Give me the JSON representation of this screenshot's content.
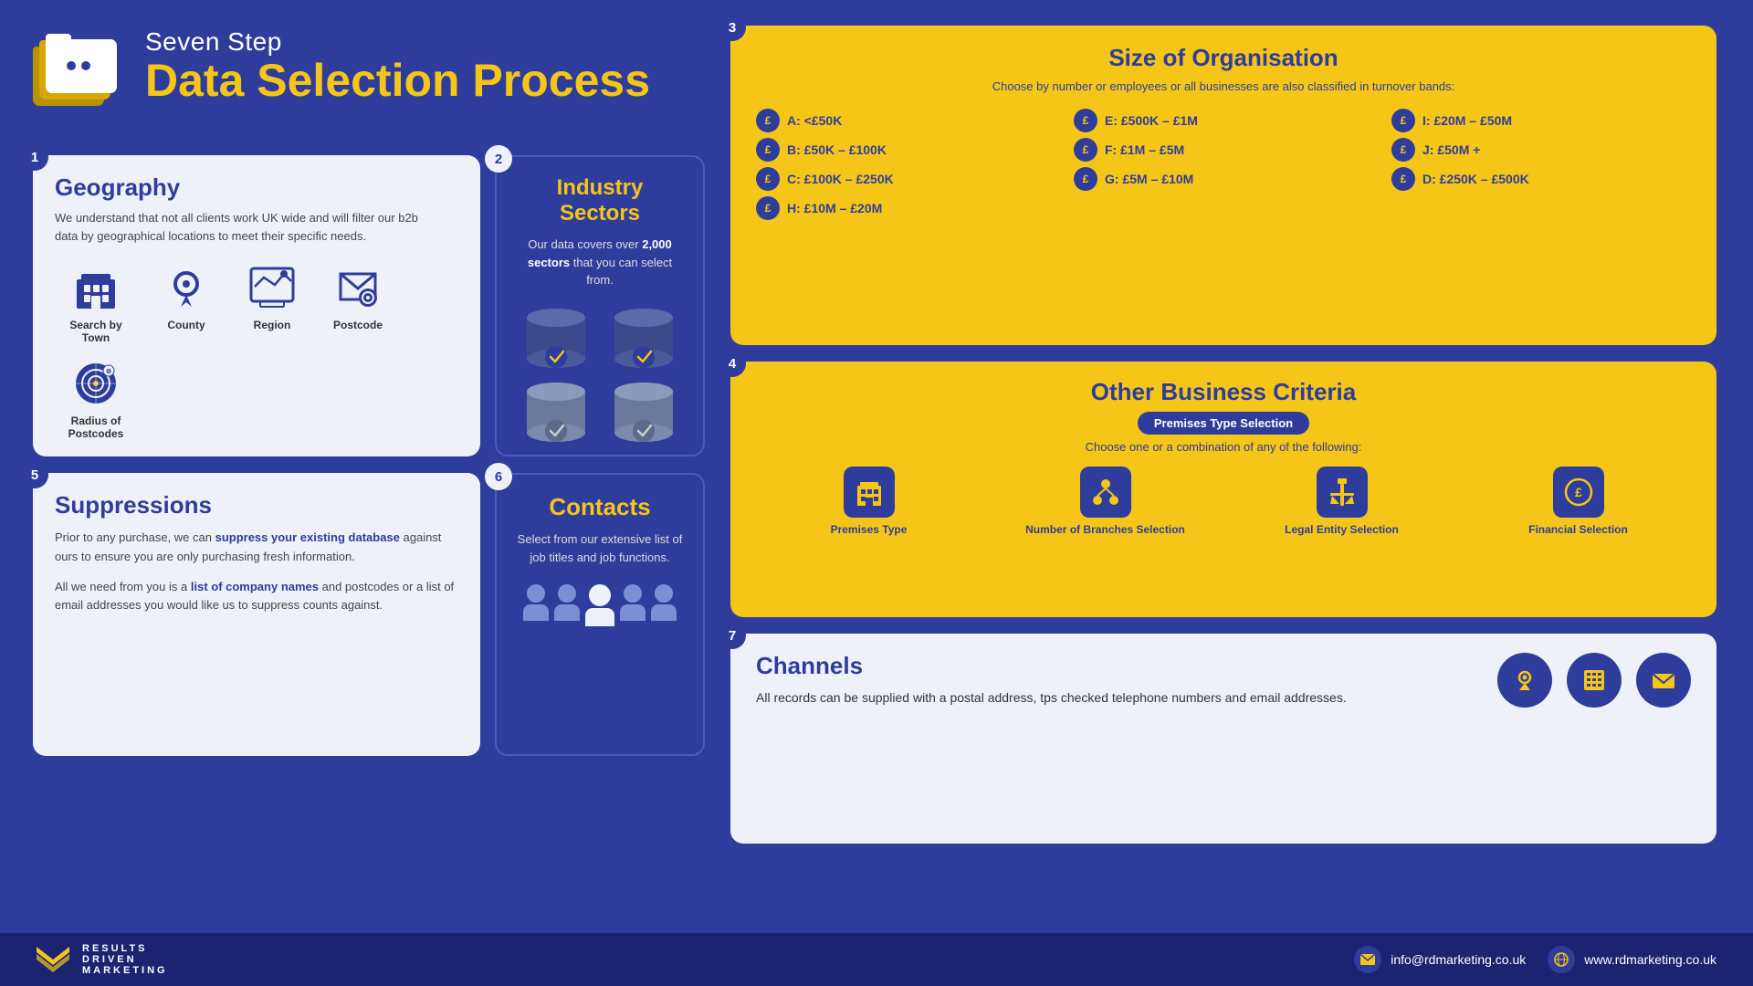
{
  "title": "Seven Step Data Selection Process",
  "header": {
    "line1": "Seven Step",
    "line2": "Data Selection Process"
  },
  "steps": {
    "step1": {
      "num": "1",
      "title": "Geography",
      "desc": "We understand that not all clients work UK wide and will filter our b2b data by geographical locations to meet their specific needs.",
      "geo_options": [
        {
          "label": "Search by Town",
          "icon": "🏙"
        },
        {
          "label": "County",
          "icon": "📍"
        },
        {
          "label": "Region",
          "icon": "🗺"
        },
        {
          "label": "Postcode",
          "icon": "📮"
        },
        {
          "label": "Radius of Postcodes",
          "icon": "🎯"
        }
      ]
    },
    "step2": {
      "num": "2",
      "title": "Industry Sectors",
      "desc": "Our data covers over 2,000 sectors that you can select from.",
      "desc_bold": "2,000"
    },
    "step3": {
      "num": "3",
      "title": "Size of Organisation",
      "desc": "Choose by number or employees or all businesses are also classified in turnover bands:",
      "bands": [
        {
          "id": "A",
          "label": "A: <£50K"
        },
        {
          "id": "B",
          "label": "B: £50K – £100K"
        },
        {
          "id": "C",
          "label": "C: £100K – £250K"
        },
        {
          "id": "D",
          "label": "D: £250K – £500K"
        },
        {
          "id": "E",
          "label": "E: £500K – £1M"
        },
        {
          "id": "F",
          "label": "F: £1M – £5M"
        },
        {
          "id": "G",
          "label": "G: £5M – £10M"
        },
        {
          "id": "H",
          "label": "H: £10M – £20M"
        },
        {
          "id": "I",
          "label": "I: £20M – £50M"
        },
        {
          "id": "J",
          "label": "J: £50M +"
        }
      ]
    },
    "step4": {
      "num": "4",
      "title": "Other Business Criteria",
      "badge": "Premises Type Selection",
      "desc": "Choose one or a combination of any of the following:",
      "criteria": [
        {
          "label": "Premises Type",
          "icon": "🏢"
        },
        {
          "label": "Number of Branches Selection",
          "icon": "👥"
        },
        {
          "label": "Legal Entity Selection",
          "icon": "⚖"
        },
        {
          "label": "Financial Selection",
          "icon": "💷"
        }
      ]
    },
    "step5": {
      "num": "5",
      "title": "Suppressions",
      "desc1": "Prior to any purchase, we can suppress your existing database against ours to ensure you are only purchasing fresh information.",
      "highlight1": "suppress your existing database",
      "desc2": "All we need from you is a list of company names and postcodes or a list of email addresses you would like us to suppress counts against.",
      "highlight2": "list of company names"
    },
    "step6": {
      "num": "6",
      "title": "Contacts",
      "desc": "Select from our extensive list of job titles and job functions."
    },
    "step7": {
      "num": "7",
      "title": "Channels",
      "desc": "All records can be supplied with a postal address, tps checked telephone numbers and email addresses."
    }
  },
  "footer": {
    "brand_lines": [
      "RESULTS",
      "DRIVEN",
      "MARKETING"
    ],
    "email": "info@rdmarketing.co.uk",
    "website": "www.rdmarketing.co.uk"
  }
}
